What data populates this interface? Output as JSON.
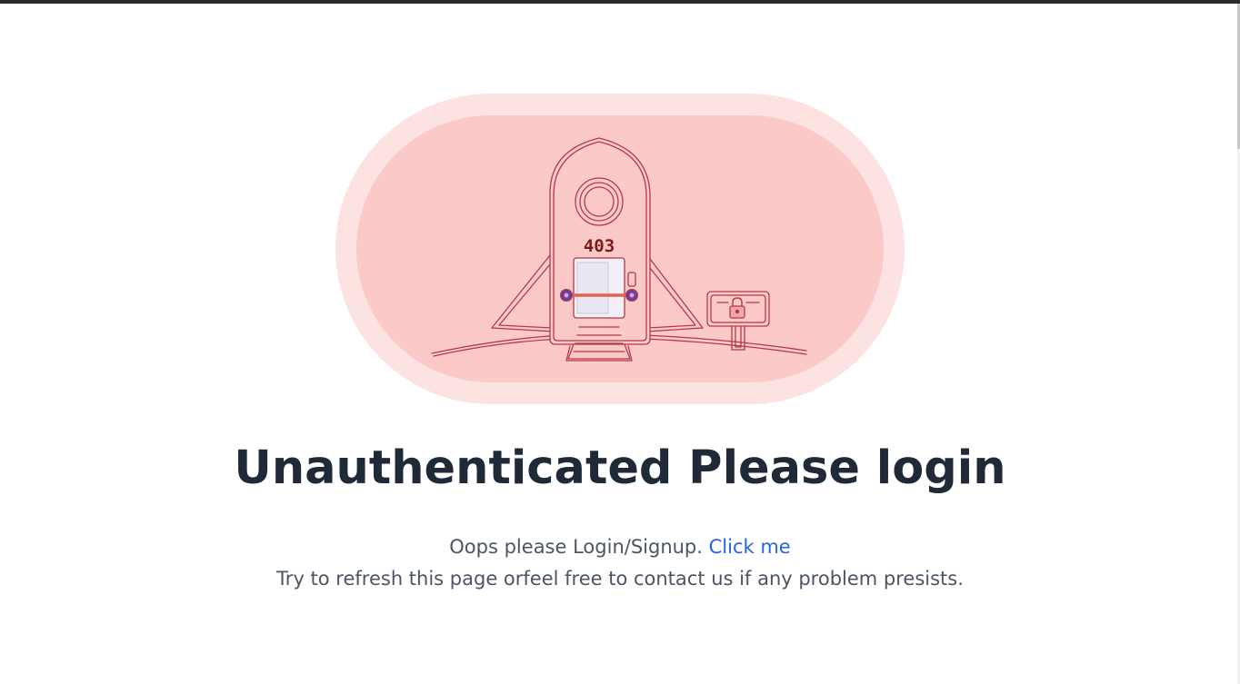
{
  "illustration": {
    "code_label": "403",
    "icon": "rocket-lock-icon",
    "colors": {
      "outer_blob": "#fde2e2",
      "inner_blob": "#fcc9c9",
      "line": "#b23a48",
      "bar": "#e5604d",
      "bolt": "#6b3fa0",
      "door": "#f2eff7",
      "text": "#7a1b1b"
    }
  },
  "headline": "Unauthenticated Please login",
  "message": {
    "line1_prefix": "Oops please Login/Signup. ",
    "link_label": "Click me",
    "line2": "Try to refresh this page orfeel free to contact us if any problem presists."
  },
  "colors": {
    "top_bar": "#2b2b2e",
    "heading": "#1f2937",
    "body_text": "#4b5563",
    "link": "#2563eb"
  }
}
